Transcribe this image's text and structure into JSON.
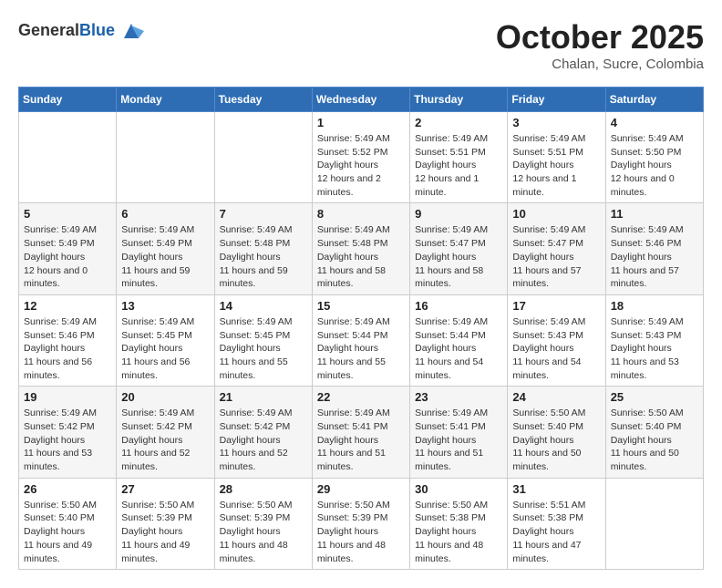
{
  "header": {
    "logo": {
      "general": "General",
      "blue": "Blue"
    },
    "title": "October 2025",
    "location": "Chalan, Sucre, Colombia"
  },
  "calendar": {
    "days_of_week": [
      "Sunday",
      "Monday",
      "Tuesday",
      "Wednesday",
      "Thursday",
      "Friday",
      "Saturday"
    ],
    "weeks": [
      [
        {
          "day": "",
          "details": ""
        },
        {
          "day": "",
          "details": ""
        },
        {
          "day": "",
          "details": ""
        },
        {
          "day": "1",
          "details": "Sunrise: 5:49 AM\nSunset: 5:52 PM\nDaylight: 12 hours and 2 minutes."
        },
        {
          "day": "2",
          "details": "Sunrise: 5:49 AM\nSunset: 5:51 PM\nDaylight: 12 hours and 1 minute."
        },
        {
          "day": "3",
          "details": "Sunrise: 5:49 AM\nSunset: 5:51 PM\nDaylight: 12 hours and 1 minute."
        },
        {
          "day": "4",
          "details": "Sunrise: 5:49 AM\nSunset: 5:50 PM\nDaylight: 12 hours and 0 minutes."
        }
      ],
      [
        {
          "day": "5",
          "details": "Sunrise: 5:49 AM\nSunset: 5:49 PM\nDaylight: 12 hours and 0 minutes."
        },
        {
          "day": "6",
          "details": "Sunrise: 5:49 AM\nSunset: 5:49 PM\nDaylight: 11 hours and 59 minutes."
        },
        {
          "day": "7",
          "details": "Sunrise: 5:49 AM\nSunset: 5:48 PM\nDaylight: 11 hours and 59 minutes."
        },
        {
          "day": "8",
          "details": "Sunrise: 5:49 AM\nSunset: 5:48 PM\nDaylight: 11 hours and 58 minutes."
        },
        {
          "day": "9",
          "details": "Sunrise: 5:49 AM\nSunset: 5:47 PM\nDaylight: 11 hours and 58 minutes."
        },
        {
          "day": "10",
          "details": "Sunrise: 5:49 AM\nSunset: 5:47 PM\nDaylight: 11 hours and 57 minutes."
        },
        {
          "day": "11",
          "details": "Sunrise: 5:49 AM\nSunset: 5:46 PM\nDaylight: 11 hours and 57 minutes."
        }
      ],
      [
        {
          "day": "12",
          "details": "Sunrise: 5:49 AM\nSunset: 5:46 PM\nDaylight: 11 hours and 56 minutes."
        },
        {
          "day": "13",
          "details": "Sunrise: 5:49 AM\nSunset: 5:45 PM\nDaylight: 11 hours and 56 minutes."
        },
        {
          "day": "14",
          "details": "Sunrise: 5:49 AM\nSunset: 5:45 PM\nDaylight: 11 hours and 55 minutes."
        },
        {
          "day": "15",
          "details": "Sunrise: 5:49 AM\nSunset: 5:44 PM\nDaylight: 11 hours and 55 minutes."
        },
        {
          "day": "16",
          "details": "Sunrise: 5:49 AM\nSunset: 5:44 PM\nDaylight: 11 hours and 54 minutes."
        },
        {
          "day": "17",
          "details": "Sunrise: 5:49 AM\nSunset: 5:43 PM\nDaylight: 11 hours and 54 minutes."
        },
        {
          "day": "18",
          "details": "Sunrise: 5:49 AM\nSunset: 5:43 PM\nDaylight: 11 hours and 53 minutes."
        }
      ],
      [
        {
          "day": "19",
          "details": "Sunrise: 5:49 AM\nSunset: 5:42 PM\nDaylight: 11 hours and 53 minutes."
        },
        {
          "day": "20",
          "details": "Sunrise: 5:49 AM\nSunset: 5:42 PM\nDaylight: 11 hours and 52 minutes."
        },
        {
          "day": "21",
          "details": "Sunrise: 5:49 AM\nSunset: 5:42 PM\nDaylight: 11 hours and 52 minutes."
        },
        {
          "day": "22",
          "details": "Sunrise: 5:49 AM\nSunset: 5:41 PM\nDaylight: 11 hours and 51 minutes."
        },
        {
          "day": "23",
          "details": "Sunrise: 5:49 AM\nSunset: 5:41 PM\nDaylight: 11 hours and 51 minutes."
        },
        {
          "day": "24",
          "details": "Sunrise: 5:50 AM\nSunset: 5:40 PM\nDaylight: 11 hours and 50 minutes."
        },
        {
          "day": "25",
          "details": "Sunrise: 5:50 AM\nSunset: 5:40 PM\nDaylight: 11 hours and 50 minutes."
        }
      ],
      [
        {
          "day": "26",
          "details": "Sunrise: 5:50 AM\nSunset: 5:40 PM\nDaylight: 11 hours and 49 minutes."
        },
        {
          "day": "27",
          "details": "Sunrise: 5:50 AM\nSunset: 5:39 PM\nDaylight: 11 hours and 49 minutes."
        },
        {
          "day": "28",
          "details": "Sunrise: 5:50 AM\nSunset: 5:39 PM\nDaylight: 11 hours and 48 minutes."
        },
        {
          "day": "29",
          "details": "Sunrise: 5:50 AM\nSunset: 5:39 PM\nDaylight: 11 hours and 48 minutes."
        },
        {
          "day": "30",
          "details": "Sunrise: 5:50 AM\nSunset: 5:38 PM\nDaylight: 11 hours and 48 minutes."
        },
        {
          "day": "31",
          "details": "Sunrise: 5:51 AM\nSunset: 5:38 PM\nDaylight: 11 hours and 47 minutes."
        },
        {
          "day": "",
          "details": ""
        }
      ]
    ]
  }
}
